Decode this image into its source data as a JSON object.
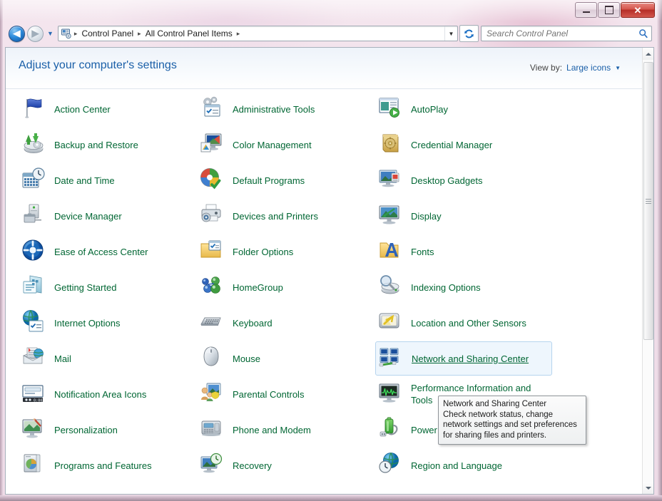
{
  "window": {
    "caption_buttons": [
      {
        "name": "minimize",
        "glyph": "minimize-icon"
      },
      {
        "name": "maximize",
        "glyph": "maximize-icon"
      },
      {
        "name": "close",
        "glyph": "close-icon",
        "label": "✕"
      }
    ]
  },
  "navbar": {
    "back_label": "◀",
    "forward_label": "▶",
    "recent_caret": "▼",
    "address_icon": "control-panel-icon",
    "breadcrumbs": [
      "Control Panel",
      "All Control Panel Items"
    ],
    "separator": "▸",
    "dropdown_caret": "▼",
    "refresh_icon": "refresh-icon",
    "search_placeholder": "Search Control Panel",
    "search_value": "",
    "search_icon": "search-icon"
  },
  "header": {
    "title": "Adjust your computer's settings",
    "view_by_label": "View by:",
    "view_by_value": "Large icons",
    "view_by_caret": "▼"
  },
  "grid": {
    "columns": [
      {
        "items": [
          {
            "label": "Action Center",
            "icon": "flag-icon"
          },
          {
            "label": "Backup and Restore",
            "icon": "backup-restore-icon"
          },
          {
            "label": "Date and Time",
            "icon": "calendar-clock-icon"
          },
          {
            "label": "Device Manager",
            "icon": "device-manager-icon"
          },
          {
            "label": "Ease of Access Center",
            "icon": "ease-of-access-icon"
          },
          {
            "label": "Getting Started",
            "icon": "getting-started-icon"
          },
          {
            "label": "Internet Options",
            "icon": "internet-options-icon"
          },
          {
            "label": "Mail",
            "icon": "mail-icon"
          },
          {
            "label": "Notification Area Icons",
            "icon": "notification-area-icon"
          },
          {
            "label": "Personalization",
            "icon": "personalization-icon"
          },
          {
            "label": "Programs and Features",
            "icon": "programs-features-icon"
          }
        ]
      },
      {
        "items": [
          {
            "label": "Administrative Tools",
            "icon": "administrative-tools-icon"
          },
          {
            "label": "Color Management",
            "icon": "color-management-icon"
          },
          {
            "label": "Default Programs",
            "icon": "default-programs-icon"
          },
          {
            "label": "Devices and Printers",
            "icon": "devices-printers-icon"
          },
          {
            "label": "Folder Options",
            "icon": "folder-options-icon"
          },
          {
            "label": "HomeGroup",
            "icon": "homegroup-icon"
          },
          {
            "label": "Keyboard",
            "icon": "keyboard-icon"
          },
          {
            "label": "Mouse",
            "icon": "mouse-icon"
          },
          {
            "label": "Parental Controls",
            "icon": "parental-controls-icon"
          },
          {
            "label": "Phone and Modem",
            "icon": "phone-modem-icon"
          },
          {
            "label": "Recovery",
            "icon": "recovery-icon"
          }
        ]
      },
      {
        "items": [
          {
            "label": "AutoPlay",
            "icon": "autoplay-icon"
          },
          {
            "label": "Credential Manager",
            "icon": "credential-manager-icon"
          },
          {
            "label": "Desktop Gadgets",
            "icon": "desktop-gadgets-icon"
          },
          {
            "label": "Display",
            "icon": "display-icon"
          },
          {
            "label": "Fonts",
            "icon": "fonts-icon"
          },
          {
            "label": "Indexing Options",
            "icon": "indexing-options-icon"
          },
          {
            "label": "Location and Other Sensors",
            "icon": "location-sensors-icon"
          },
          {
            "label": "Network and Sharing Center",
            "icon": "network-sharing-icon",
            "hovered": true
          },
          {
            "label": "Performance Information and Tools",
            "icon": "performance-info-icon"
          },
          {
            "label": "Power Options",
            "icon": "power-options-icon"
          },
          {
            "label": "Region and Language",
            "icon": "region-language-icon"
          }
        ]
      }
    ]
  },
  "tooltip": {
    "title": "Network and Sharing Center",
    "line1": "Check network status, change",
    "line2": "network settings and set preferences",
    "line3": "for sharing files and printers."
  },
  "scrollbar": {
    "up_arrow": "scroll-up-icon",
    "down_arrow": "scroll-down-icon"
  },
  "colors": {
    "item_text": "#006633",
    "title_text": "#1a5fa8",
    "accent": "#1a5fa8",
    "frame": "#eedbe7"
  }
}
